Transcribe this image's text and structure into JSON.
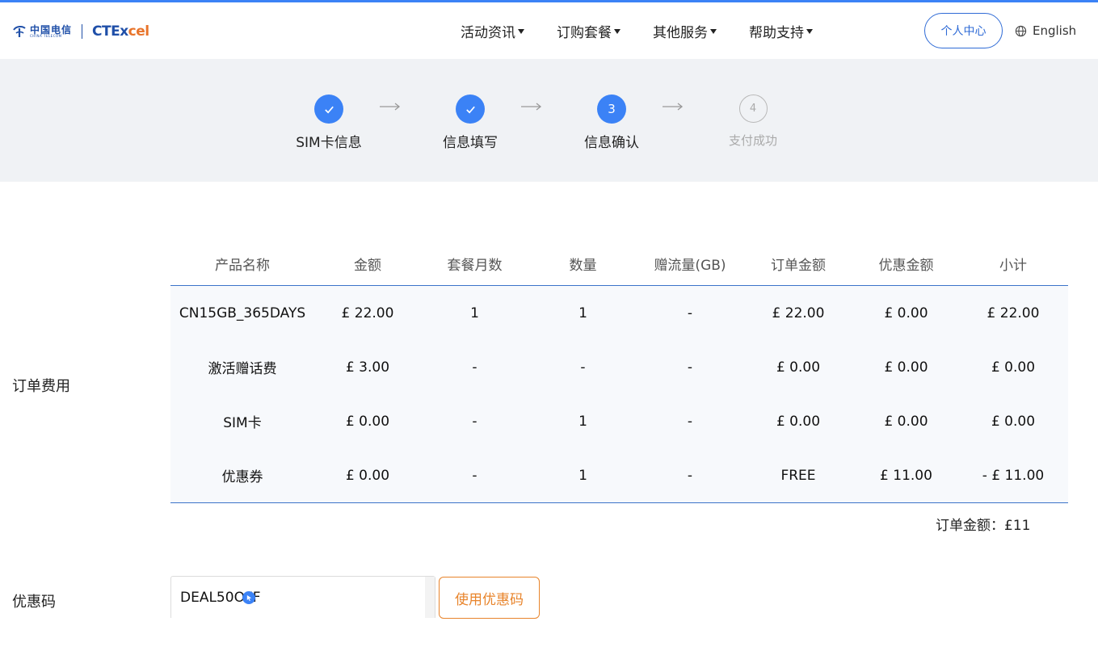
{
  "brand": {
    "telecom_cn": "中国电信",
    "telecom_en": "CHINA TELECOM",
    "sub_brand_a": "CTEx",
    "sub_brand_b": "cel",
    "brand_blue": "#1f4fa8",
    "brand_orange": "#e8742b"
  },
  "nav": [
    {
      "label": "活动资讯"
    },
    {
      "label": "订购套餐"
    },
    {
      "label": "其他服务"
    },
    {
      "label": "帮助支持"
    }
  ],
  "header": {
    "personal_center": "个人中心",
    "language": "English",
    "language_icon": "globe-icon"
  },
  "steps": [
    {
      "label": "SIM卡信息",
      "state": "done",
      "icon": "check-icon"
    },
    {
      "label": "信息填写",
      "state": "done",
      "icon": "check-icon"
    },
    {
      "label": "信息确认",
      "state": "active",
      "number": "3"
    },
    {
      "label": "支付成功",
      "state": "pending",
      "number": "4"
    }
  ],
  "order": {
    "section_label": "订单费用",
    "columns": [
      "产品名称",
      "金额",
      "套餐月数",
      "数量",
      "赠流量(GB)",
      "订单金额",
      "优惠金额",
      "小计"
    ],
    "rows": [
      [
        "CN15GB_365DAYS",
        "£ 22.00",
        "1",
        "1",
        "-",
        "£ 22.00",
        "£ 0.00",
        "£ 22.00"
      ],
      [
        "激活赠话费",
        "£ 3.00",
        "-",
        "-",
        "-",
        "£ 0.00",
        "£ 0.00",
        "£ 0.00"
      ],
      [
        "SIM卡",
        "£ 0.00",
        "-",
        "1",
        "-",
        "£ 0.00",
        "£ 0.00",
        "£ 0.00"
      ],
      [
        "优惠券",
        "£ 0.00",
        "-",
        "1",
        "-",
        "FREE",
        "£ 11.00",
        "- £ 11.00"
      ]
    ],
    "total_label": "订单金额：",
    "total_value": "£11"
  },
  "coupon": {
    "section_label": "优惠码",
    "value": "DEAL50OFF",
    "apply_button": "使用优惠码"
  },
  "colors": {
    "accent": "#3b82f6",
    "step_band": "#f0f2f5",
    "table_line": "#3b74c9",
    "apply_orange": "#e8842b"
  }
}
